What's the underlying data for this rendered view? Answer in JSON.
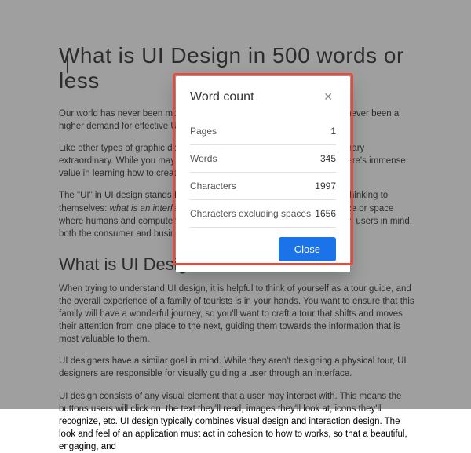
{
  "document": {
    "title": "What is UI Design in 500 words or less",
    "p1": "Our world has never been more dependent on technology, so there has never been a higher demand for effective UI design.",
    "p2": "Like other types of graphic design, UI design is all about making the ordinary extraordinary. While you may not be aiming for a fine-art masterpiece, there's immense value in learning how to create a functional UI design.",
    "p3a": "The \"UI\" in UI design stands for user interface, so you may find yourself thinking to themselves: ",
    "p3b": "what is an interface?",
    "p3c": " In simple terms, an interface is the place or space where humans and computers interact. When you understand design with users in mind, both the consumer and business marketing become remarkably simple.",
    "h2": "What is UI Design?",
    "p4": "When trying to understand UI design, it is helpful to think of yourself as a tour guide, and the overall experience of a family of tourists is in your hands. You want to ensure that this family will have a wonderful journey, so you'll want to craft a tour that shifts and moves their attention from one place to the next, guiding them towards the information that is most valuable to them.",
    "p5": "UI designers have a similar goal in mind. While they aren't designing a physical tour, UI designers are responsible for visually guiding a user through an interface.",
    "p6": "UI design consists of any visual element that a user may interact with. This means the buttons users will click on, the text they'll read, images they'll look at, icons they'll recognize, etc. UI design typically combines visual design and interaction design. The look and feel of an application must act in cohesion to how to works, so that a beautiful, engaging, and"
  },
  "dialog": {
    "title": "Word count",
    "rows": [
      {
        "label": "Pages",
        "value": "1"
      },
      {
        "label": "Words",
        "value": "345"
      },
      {
        "label": "Characters",
        "value": "1997"
      },
      {
        "label": "Characters excluding spaces",
        "value": "1656"
      }
    ],
    "close_label": "Close"
  }
}
